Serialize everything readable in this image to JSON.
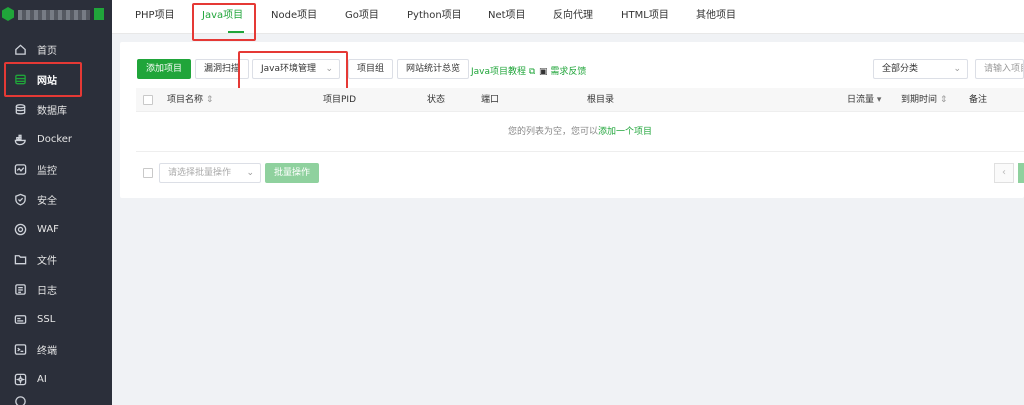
{
  "sidebar": {
    "items": [
      {
        "label": "首页",
        "icon": "home-icon"
      },
      {
        "label": "网站",
        "icon": "website-icon"
      },
      {
        "label": "数据库",
        "icon": "database-icon"
      },
      {
        "label": "Docker",
        "icon": "docker-icon"
      },
      {
        "label": "监控",
        "icon": "monitor-icon"
      },
      {
        "label": "安全",
        "icon": "shield-icon"
      },
      {
        "label": "WAF",
        "icon": "waf-icon"
      },
      {
        "label": "文件",
        "icon": "folder-icon"
      },
      {
        "label": "日志",
        "icon": "log-icon"
      },
      {
        "label": "SSL",
        "icon": "ssl-icon"
      },
      {
        "label": "终端",
        "icon": "terminal-icon"
      },
      {
        "label": "AI",
        "icon": "ai-icon"
      }
    ]
  },
  "tabs": [
    "PHP项目",
    "Java项目",
    "Node项目",
    "Go项目",
    "Python项目",
    "Net项目",
    "反向代理",
    "HTML项目",
    "其他项目"
  ],
  "toolbar": {
    "add_project": "添加项目",
    "vuln_scan": "漏洞扫描",
    "java_env": "Java环境管理",
    "project_group": "项目组",
    "site_stats": "网站统计总览",
    "tutorial": "Java项目教程",
    "feedback": "需求反馈",
    "category": "全部分类",
    "search_placeholder": "请输入项目"
  },
  "table": {
    "headers": [
      "项目名称",
      "项目PID",
      "状态",
      "端口",
      "根目录",
      "日流量",
      "到期时间",
      "备注"
    ],
    "empty_text": "您的列表为空，您可以",
    "empty_link": "添加一个项目"
  },
  "footer": {
    "batch_placeholder": "请选择批量操作",
    "batch_button": "批量操作",
    "prev_page": "‹"
  },
  "colors": {
    "accent": "#20a53a",
    "sidebar_bg": "#2b2f3a",
    "highlight": "#e53935"
  }
}
